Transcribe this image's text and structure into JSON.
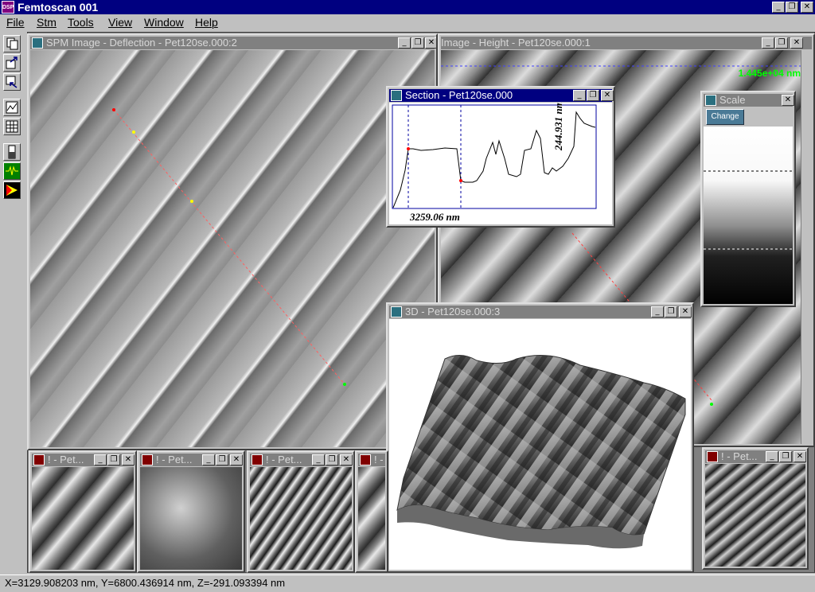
{
  "app": {
    "title": "Femtoscan 001",
    "icon": "DSP"
  },
  "window_controls": {
    "minimize": "_",
    "restore": "❐",
    "close": "✕"
  },
  "menu": [
    "File",
    "Stm",
    "Tools",
    "View",
    "Window",
    "Help"
  ],
  "windows": {
    "deflection": {
      "title": "SPM Image -  Deflection - Pet120se.000:2"
    },
    "height": {
      "title": "Image -  Height - Pet120se.000:1",
      "readout": "1.445e+04 nm"
    },
    "section": {
      "title": "Section - Pet120se.000",
      "x_readout": "3259.06 nm",
      "y_readout": "244.931 nm"
    },
    "scale": {
      "title": "Scale",
      "change_button": "Change"
    },
    "view3d": {
      "title": "3D - Pet120se.000:3"
    },
    "thumbs": [
      {
        "title": "! - Pet..."
      },
      {
        "title": "! - Pet..."
      },
      {
        "title": "! - Pet..."
      },
      {
        "title": "! - Pet..."
      },
      {
        "title": "! - Pet..."
      }
    ]
  },
  "status": {
    "text": "X=3129.908203 nm, Y=6800.436914 nm, Z=-291.093394 nm"
  },
  "colors": {
    "active_title": "#000080",
    "inactive_title": "#808080",
    "readout_green": "#00ff00",
    "section_line": "#0000a0"
  },
  "icons": [
    "copy-icon",
    "export-icon",
    "import-icon",
    "profile-icon",
    "grid-icon",
    "bar-icon",
    "wave-icon",
    "arrow-icon"
  ]
}
